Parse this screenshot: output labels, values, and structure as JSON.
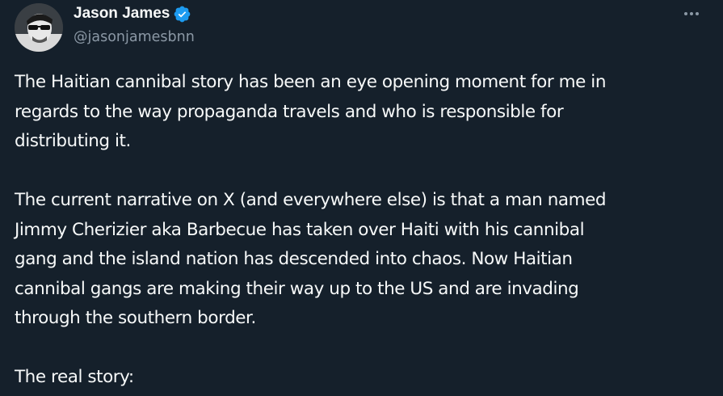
{
  "author": {
    "name": "Jason James",
    "handle": "@jasonjamesbnn",
    "verified_icon": "verified-badge-icon",
    "avatar_icon": "profile-avatar"
  },
  "menu": {
    "more_icon": "more-options-icon"
  },
  "tweet": {
    "paragraphs": [
      [
        "The Haitian cannibal story has been an eye opening moment for me in",
        "regards to the way propaganda travels and who is responsible for",
        "distributing it."
      ],
      [
        "The current narrative on X (and everywhere else) is that a man named",
        "Jimmy Cherizier aka Barbecue has taken over Haiti with his cannibal",
        "gang and the island nation has descended into chaos. Now Haitian",
        "cannibal gangs are making their way up to the US and are invading",
        "through the southern border."
      ],
      [
        "The real story:"
      ]
    ]
  },
  "colors": {
    "background": "#15202b",
    "text_primary": "#f7f9f9",
    "text_secondary": "#8b98a5",
    "verified_blue": "#1d9bf0"
  }
}
